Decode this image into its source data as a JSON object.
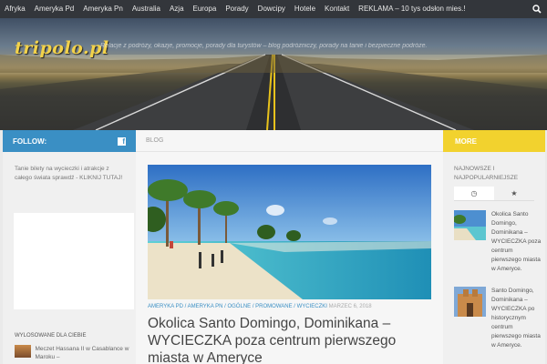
{
  "nav": {
    "items": [
      "Afryka",
      "Ameryka Pd",
      "Ameryka Pn",
      "Australia",
      "Azja",
      "Europa",
      "Porady",
      "Dowcipy",
      "Hotele",
      "Kontakt",
      "REKLAMA – 10 tys odsłon mies.!"
    ],
    "search_icon": "search-icon"
  },
  "header": {
    "logo": "tripolo.pl",
    "tagline": "Relacje z podróży, okazje, promocje, porady dla turystów – blog podróżniczy, porady na tanie i bezpieczne podróże."
  },
  "left": {
    "heading": "FOLLOW:",
    "social_icon": "facebook-icon",
    "promo_text": "Tanie bilety na wycieczki i atrakcje z całego świata sprawdź - KLIKNIJ TUTAJ!",
    "random_title": "WYLOSOWANE DLA CIEBIE",
    "random_item": "Meczet Hassana II w Casablance w Maroku –"
  },
  "main": {
    "heading": "BLOG",
    "categories": "AMERYKA PD / AMERYKA PN / OGÓLNE / PROMOWANE / WYCIECZKI",
    "date": "MARZEC 6, 2018",
    "post_title": "Okolica Santo Domingo, Dominikana – WYCIECZKA poza centrum pierwszego miasta w Ameryce"
  },
  "right": {
    "heading": "MORE",
    "label": "NAJNOWSZE I NAJPOPULARNIEJSZE",
    "tabs": [
      {
        "icon": "clock-icon",
        "glyph": "◷"
      },
      {
        "icon": "star-icon",
        "glyph": "★"
      }
    ],
    "posts": [
      "Okolica Santo Domingo, Dominikana – WYCIECZKA poza centrum pierwszego miasta w Ameryce.",
      "Santo Domingo, Dominikana – WYCIECZKA po historycznym centrum pierwszego miasta w Ameryce."
    ]
  },
  "colors": {
    "nav_bg": "#33363b",
    "follow_blue": "#3a8fc4",
    "more_yellow": "#f2d22e",
    "logo_yellow": "#f2d24b"
  }
}
